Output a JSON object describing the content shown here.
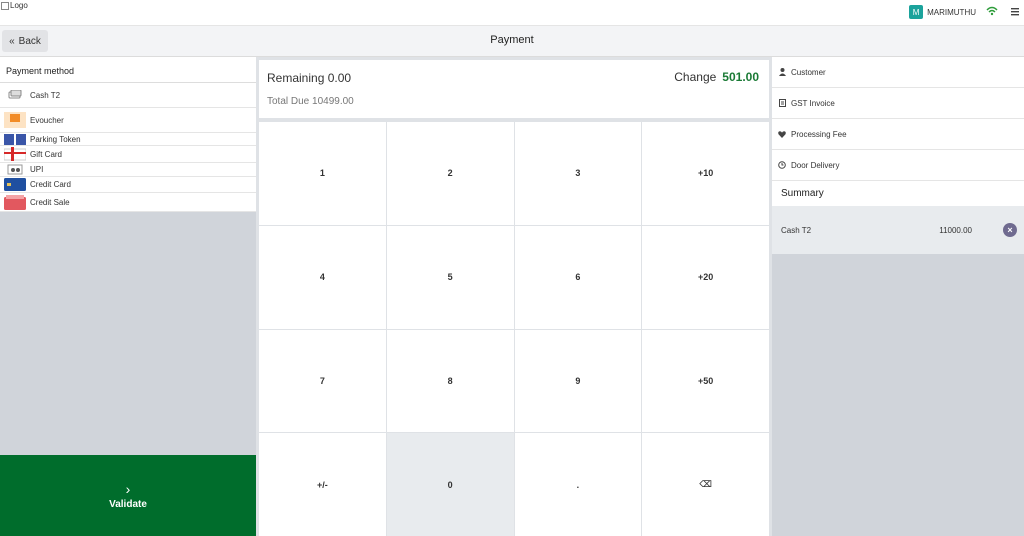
{
  "topbar": {
    "logo_text": "Logo",
    "user_initial": "M",
    "user_name": "MARIMUTHU"
  },
  "header": {
    "back_label": "Back",
    "title": "Payment"
  },
  "payment_methods": {
    "heading": "Payment method",
    "items": [
      {
        "label": "Cash T2",
        "icon": "cash-icon"
      },
      {
        "label": "Evoucher",
        "icon": "evoucher-icon"
      },
      {
        "label": "Parking Token",
        "icon": "parking-token-icon"
      },
      {
        "label": "Gift Card",
        "icon": "gift-card-icon"
      },
      {
        "label": "UPI",
        "icon": "upi-icon"
      },
      {
        "label": "Credit Card",
        "icon": "credit-card-icon"
      },
      {
        "label": "Credit Sale",
        "icon": "credit-sale-icon"
      }
    ]
  },
  "amounts": {
    "remaining_label": "Remaining",
    "remaining_value": "0.00",
    "total_due_label": "Total Due",
    "total_due_value": "10499.00",
    "change_label": "Change",
    "change_value": "501.00"
  },
  "keypad": {
    "keys": [
      "1",
      "2",
      "3",
      "+10",
      "4",
      "5",
      "6",
      "+20",
      "7",
      "8",
      "9",
      "+50",
      "+/-",
      "0",
      ".",
      "⌫"
    ]
  },
  "validate": {
    "label": "Validate"
  },
  "options": [
    {
      "label": "Customer",
      "icon": "user-icon"
    },
    {
      "label": "GST Invoice",
      "icon": "invoice-icon"
    },
    {
      "label": "Processing Fee",
      "icon": "heart-icon"
    },
    {
      "label": "Door Delivery",
      "icon": "clock-icon"
    }
  ],
  "summary": {
    "heading": "Summary",
    "lines": [
      {
        "method": "Cash T2",
        "amount": "11000.00"
      }
    ]
  },
  "colors": {
    "validate_bg": "#006d2c",
    "change_value": "#1a7a35",
    "avatar": "#1ba39c",
    "remove_button": "#6f6a8f"
  }
}
